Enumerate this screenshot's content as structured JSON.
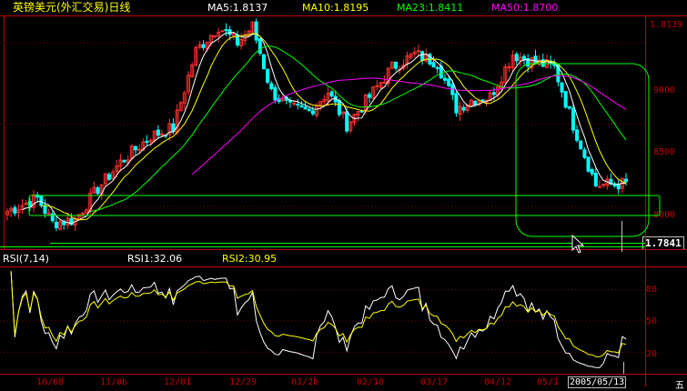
{
  "header": {
    "title": "英镑美元(外汇交易)日线",
    "ma_labels": [
      {
        "text": "MA5:1.8137",
        "color": "#ffffff"
      },
      {
        "text": "MA10:1.8195",
        "color": "#ffff00"
      },
      {
        "text": "MA23:1.8411",
        "color": "#00ff00"
      },
      {
        "text": "MA50:1.8700",
        "color": "#ff00ff"
      }
    ]
  },
  "rsi_header": {
    "name": "RSI(7,14)",
    "rsi1": "RSI1:32.06",
    "rsi2": "RSI2:30.95"
  },
  "price_axis": {
    "top_label": "1.8139",
    "labels": [
      "9000",
      "8500",
      "8000"
    ],
    "current_price": "1.7841"
  },
  "rsi_axis": {
    "labels": [
      "80",
      "50",
      "20"
    ]
  },
  "date_axis": {
    "labels": [
      "10/08",
      "11/0b",
      "12/01",
      "12/29",
      "01/2b",
      "02/10",
      "03/17",
      "04/12",
      "05/1",
      "2005/05/13",
      "五"
    ]
  },
  "colors": {
    "up_candle": "#ff3030",
    "down_candle": "#00ffff",
    "ma5": "#ffffff",
    "ma10": "#ffff00",
    "ma23": "#00ff00",
    "ma50": "#ff00ff",
    "grid": "#800000",
    "axis_text": "#c00000",
    "annotation": "#00ff00",
    "rsi1": "#ffffff",
    "rsi2": "#ffff00"
  },
  "chart_data": {
    "type": "candlestick",
    "title": "英镑美元(外汇交易)日线",
    "y_label_format": "1.XXXX",
    "ylim": [
      1.775,
      1.915
    ],
    "price_gridlines": [
      1.9,
      1.85,
      1.8
    ],
    "candles_approx_count": 165,
    "anchor_closes": [
      {
        "i": 0,
        "close": 1.797
      },
      {
        "i": 8,
        "close": 1.805
      },
      {
        "i": 12,
        "close": 1.79
      },
      {
        "i": 18,
        "close": 1.792
      },
      {
        "i": 24,
        "close": 1.811
      },
      {
        "i": 30,
        "close": 1.827
      },
      {
        "i": 38,
        "close": 1.843
      },
      {
        "i": 44,
        "close": 1.848
      },
      {
        "i": 50,
        "close": 1.895
      },
      {
        "i": 56,
        "close": 1.91
      },
      {
        "i": 61,
        "close": 1.9
      },
      {
        "i": 65,
        "close": 1.91
      },
      {
        "i": 70,
        "close": 1.87
      },
      {
        "i": 75,
        "close": 1.86
      },
      {
        "i": 80,
        "close": 1.858
      },
      {
        "i": 85,
        "close": 1.87
      },
      {
        "i": 90,
        "close": 1.85
      },
      {
        "i": 96,
        "close": 1.867
      },
      {
        "i": 102,
        "close": 1.885
      },
      {
        "i": 108,
        "close": 1.893
      },
      {
        "i": 114,
        "close": 1.888
      },
      {
        "i": 119,
        "close": 1.86
      },
      {
        "i": 123,
        "close": 1.865
      },
      {
        "i": 128,
        "close": 1.867
      },
      {
        "i": 134,
        "close": 1.893
      },
      {
        "i": 140,
        "close": 1.888
      },
      {
        "i": 145,
        "close": 1.885
      },
      {
        "i": 150,
        "close": 1.85
      },
      {
        "i": 156,
        "close": 1.813
      },
      {
        "i": 164,
        "close": 1.814
      }
    ],
    "moving_averages": [
      {
        "name": "MA5",
        "last": 1.8137
      },
      {
        "name": "MA10",
        "last": 1.8195
      },
      {
        "name": "MA23",
        "last": 1.8411
      },
      {
        "name": "MA50",
        "last": 1.87
      }
    ],
    "rsi": {
      "ylim": [
        0,
        100
      ],
      "levels": [
        80,
        50,
        20
      ],
      "rsi1_last": 32.06,
      "rsi2_last": 30.95
    }
  }
}
